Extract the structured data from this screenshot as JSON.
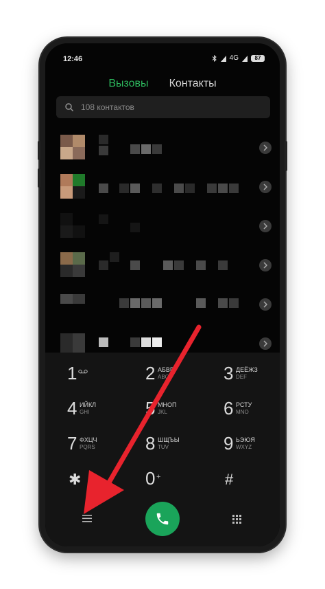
{
  "status_bar": {
    "time": "12:46",
    "network": "4G",
    "battery": "87",
    "icons": [
      "bluetooth-icon",
      "signal-icon",
      "battery-icon"
    ]
  },
  "tabs": [
    {
      "label": "Вызовы",
      "active": true
    },
    {
      "label": "Контакты",
      "active": false
    }
  ],
  "search": {
    "placeholder": "108 контактов",
    "icon": "search-icon"
  },
  "contacts": {
    "row_count": 6,
    "note_icon": "chevron-right-icon"
  },
  "dialpad": {
    "keys": [
      {
        "digit": "1",
        "letters": "",
        "latin": "",
        "icon": "voicemail-icon"
      },
      {
        "digit": "2",
        "letters": "АБВГ",
        "latin": "ABC"
      },
      {
        "digit": "3",
        "letters": "ДЕЁЖЗ",
        "latin": "DEF"
      },
      {
        "digit": "4",
        "letters": "ИЙКЛ",
        "latin": "GHI"
      },
      {
        "digit": "5",
        "letters": "МНОП",
        "latin": "JKL"
      },
      {
        "digit": "6",
        "letters": "РСТУ",
        "latin": "MNO"
      },
      {
        "digit": "7",
        "letters": "ФХЦЧ",
        "latin": "PQRS"
      },
      {
        "digit": "8",
        "letters": "ШЩЪЫ",
        "latin": "TUV"
      },
      {
        "digit": "9",
        "letters": "ЬЭЮЯ",
        "latin": "WXYZ"
      },
      {
        "digit": "✱",
        "letters": "",
        "latin": ""
      },
      {
        "digit": "0",
        "letters": "+",
        "latin": ""
      },
      {
        "digit": "#",
        "letters": "",
        "latin": ""
      }
    ]
  },
  "bottom_bar": {
    "menu_icon": "menu-icon",
    "call_icon": "phone-icon",
    "keypad_icon": "dialpad-grid-icon"
  },
  "colors": {
    "accent": "#2db85d",
    "call_button": "#1aa45a",
    "arrow": "#e8232d"
  }
}
